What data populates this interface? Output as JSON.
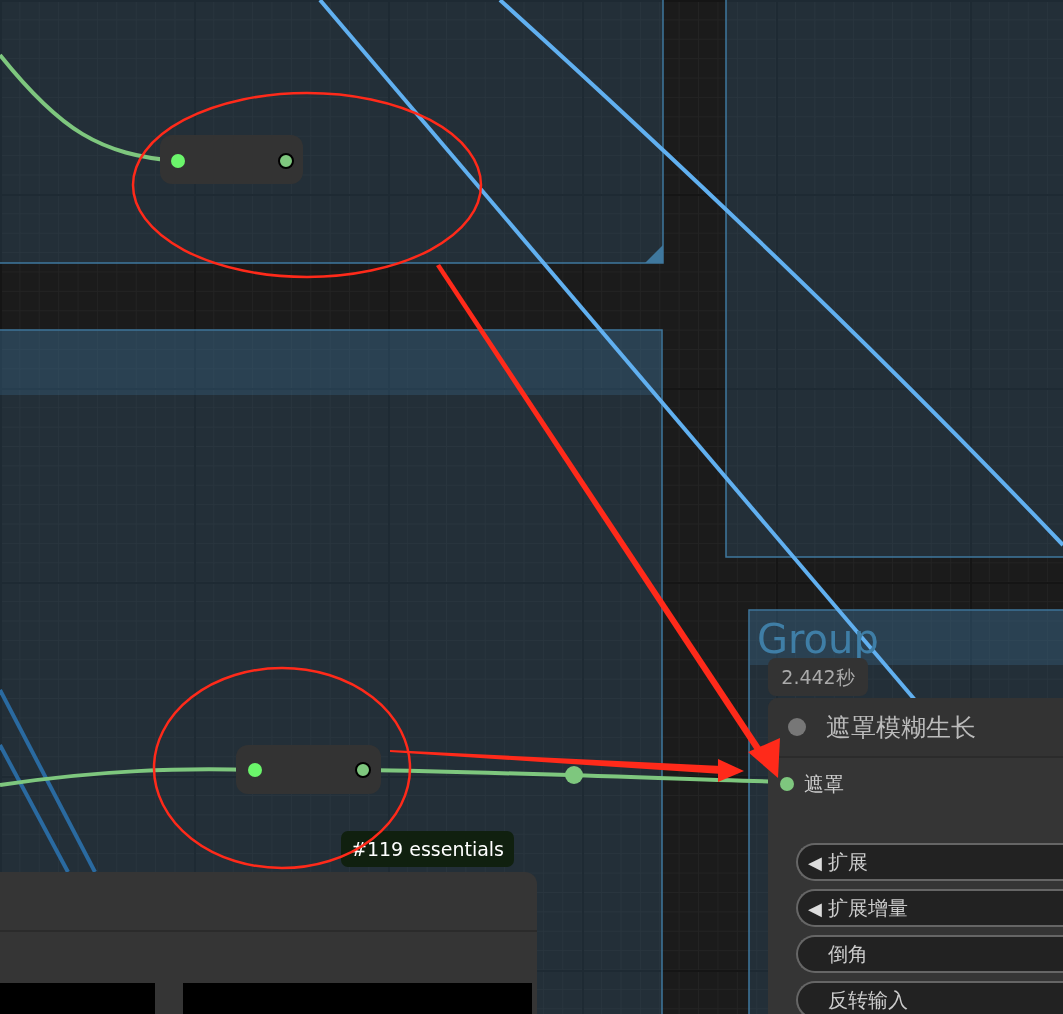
{
  "group_title": "Group",
  "execution_time": "2.442秒",
  "node": {
    "title": "遮罩模糊生长",
    "inputs": [
      {
        "label": "遮罩"
      }
    ],
    "widgets": [
      {
        "kind": "number",
        "arrow": "◀",
        "label": "扩展"
      },
      {
        "kind": "number",
        "arrow": "◀",
        "label": "扩展增量"
      },
      {
        "kind": "toggle",
        "label": "倒角"
      },
      {
        "kind": "toggle",
        "label": "反转输入"
      }
    ]
  },
  "tooltip": "#119 essentials"
}
